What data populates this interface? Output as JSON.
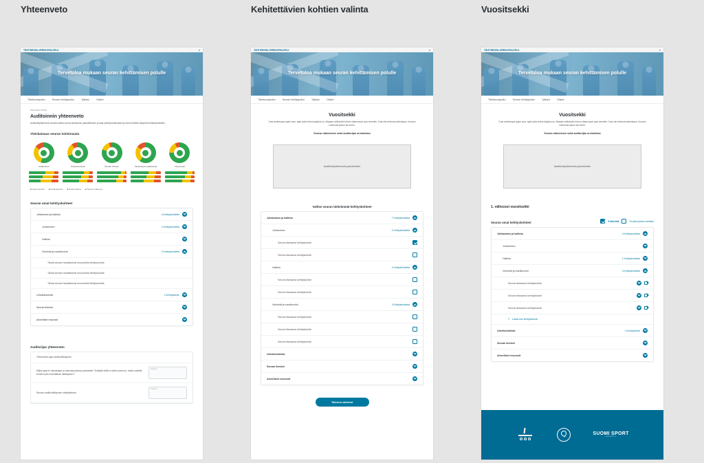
{
  "columns": {
    "a": {
      "title": "Yhteenveto"
    },
    "b": {
      "title": "Kehitettävien kohtien valinta"
    },
    "c": {
      "title": "Vuositsekki"
    }
  },
  "shared": {
    "brand": "TÄHTISEURA-VERKKOPALVELU",
    "hero": "Tervetuloa mukaan seuran kehittämisen polulle",
    "nav": [
      "Tähtiseurapolku",
      "Seuran kehityspolku",
      "Tylikalu",
      "Ohjeet"
    ]
  },
  "col1": {
    "crumbs": "HELSINKI HAWS",
    "h1": "Auditoinnin yhteenveto",
    "lead": "Auditointiyhteenveto-sivulla vaihtuu seura-auditoinnin palautteeseen ja saat yhteisymmärryksen ja koko tiimillesi näkymän kehityskohteisiin.",
    "overview_title": "Yleiskatsaus seuran toiminnasta",
    "donuts": [
      {
        "label": "Johtaminen",
        "g": 55,
        "y": 30,
        "r": 15
      },
      {
        "label": "Urheilutoiminta",
        "g": 70,
        "y": 20,
        "r": 10
      },
      {
        "label": "Seuran ihmiset",
        "g": 80,
        "y": 15,
        "r": 5
      },
      {
        "label": "Viestintä ja markkinointi",
        "g": 60,
        "y": 25,
        "r": 15
      },
      {
        "label": "Yhteenveto",
        "g": 75,
        "y": 18,
        "r": 7
      }
    ],
    "legend": [
      "Hyvä toiminta",
      "Kehityskohde",
      "Parannettava",
      "Seuran näkemys"
    ],
    "own_title": "Seuran omat kehityskohteet",
    "cardA": {
      "header": {
        "label": "Johtaminen ja hallinto",
        "count": "4 Kehityskohdetta"
      },
      "rows": [
        {
          "label": "Johtaminen",
          "count": "1 Kehityskohdetta"
        },
        {
          "label": "Hallinto"
        },
        {
          "label": "Viestintä ja markkinointi",
          "count": "3 Kehityskohdetta"
        },
        {
          "label": "Tässä seuran havaitsemat muomotilat kehityskohde"
        },
        {
          "label": "Tässä seuran havaitsemat muomotilat kehityskohde"
        },
        {
          "label": "Tässä seuran havaitsemat muomotilat kehityskohde"
        }
      ],
      "closed": [
        {
          "label": "Urheilutoiminta",
          "count": "1 Kehityskohde"
        },
        {
          "label": "Seuran ihmiset"
        },
        {
          "label": "Aineelliset resurssit"
        }
      ]
    },
    "auditor_title": "Auditorijan yhteenveto",
    "auditor_rows": [
      {
        "label": "Yhteenveto-ajan auditointikäynnin"
      },
      {
        "q": "Mitkä asiat te oikeastaan ja tulevaisuudessa painotatte? Entäistä teillä ei sitten tuntunut, mutta voitsitte tehdä myös merkittävän lisätarpeen?",
        "ph": "Vastaus"
      },
      {
        "q": "Seuran auditointikäynnin mielipiteenne",
        "ph": "Vastaus"
      }
    ]
  },
  "col2": {
    "h1": "Vuositsekki",
    "lead": "Cras scelerisque quam arcu, eget porta lectus dapibus eu. Aliquam sollicitudin rutrum ullamcorper quis venentis. Cras nisl vehicula scelerisque, rhoncus commodo-ipsum dui lorem.",
    "sub": "Seuran näkeminen sekä auditorijan arviointiasi",
    "ph": "Auditointiyhteenveto-placeholder",
    "choose": "Valitse seuran tärkeimmät kehityskohteet",
    "sec1": {
      "label": "Johtaminen ja hallinto",
      "count": "7 Kehityskohdetta"
    },
    "rows1": [
      {
        "label": "Johtaminen",
        "count": "2 Kehityskohdetta"
      },
      {
        "label": "Seuran itseaama kehityskohde",
        "checked": true
      },
      {
        "label": "Seuran itseaama kehityskohde",
        "checked": false
      }
    ],
    "sec2": {
      "label": "Hallinto",
      "count": "2 Kehityskohdetta"
    },
    "rows2": [
      {
        "label": "Seuran itseaama kehityskohde",
        "checked": false
      },
      {
        "label": "Seuran itseaama kehityskohde",
        "checked": false
      }
    ],
    "sec3": {
      "label": "Viestintä ja markkinointi",
      "count": "3 Kehityskohdetta"
    },
    "rows3": [
      {
        "label": "Seuran itseaama kehityskohde",
        "checked": false
      },
      {
        "label": "Seuran itseaama kehityskohde",
        "checked": false
      },
      {
        "label": "Seuran itseaama kehityskohde",
        "checked": false
      }
    ],
    "closed": [
      {
        "label": "Urheilutoiminta"
      },
      {
        "label": "Seuran ihmiset"
      },
      {
        "label": "Aineelliset resurssit"
      }
    ],
    "btn": "Talenna valinnat"
  },
  "col3": {
    "h1": "Vuositsekki",
    "lead": "Cras scelerisque quam arcu, eget porta lectus dapibus eu. Aliquam sollicitudin rutrum ullamcorper quis venentis. Cras nisl vehicula scelerisque, rhoncus commodo-ipsum dui lorem.",
    "sub": "Seuran näkeminen sekä auditorijan arviointiasi",
    "ph": "Auditointiyhteenveto-placeholder",
    "year_label": "1. välivuosi vuositsekki",
    "own": "Seuran omat kehityskohteet",
    "toggle_a": "5 tärkeintä",
    "toggle_b": "15 pidennuksen kohdetta",
    "sec1": {
      "label": "Johtaminen ja hallinto",
      "count": "4 Kehityskohdetta"
    },
    "rows1": [
      {
        "label": "Johtaminen"
      },
      {
        "label": "Hallinto",
        "count": "1 Kehityskohdetta"
      },
      {
        "label": "Viestintä ja markkinointi",
        "count": "3 Kehityskohdetta"
      },
      {
        "label": "Seuran itseaama kehityskohde",
        "pen": true
      },
      {
        "label": "Seuran itseaama kehityskohde",
        "pen": true
      },
      {
        "label": "Seuran itseaama kehityskohde",
        "pen": true
      }
    ],
    "add": "Lisää uusi kehityskohde",
    "closed": [
      {
        "label": "Urheilutoiminta",
        "count": "1 Kehityskohde"
      },
      {
        "label": "Seuran ihmiset"
      },
      {
        "label": "Aineelliset resurssit"
      }
    ],
    "footer": {
      "suomi": "SUOMI SPORT",
      "tag": "seuralle.fi"
    }
  }
}
